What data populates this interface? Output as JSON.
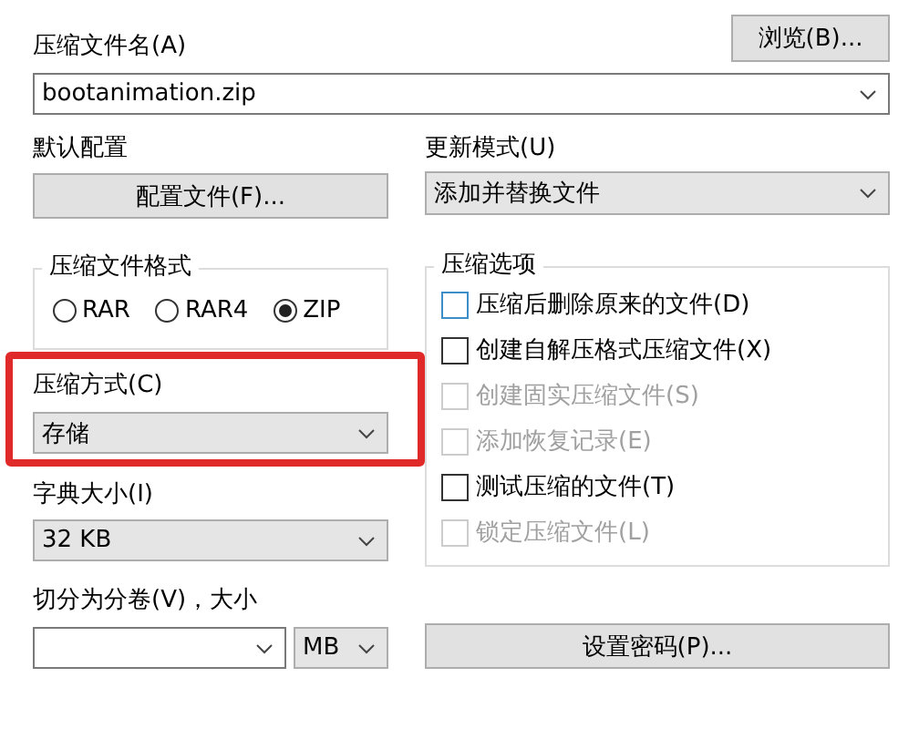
{
  "archive_name": {
    "label": "压缩文件名(A)",
    "value": "bootanimation.zip"
  },
  "browse_button": "浏览(B)...",
  "profile": {
    "label": "默认配置",
    "button": "配置文件(F)..."
  },
  "update_mode": {
    "label": "更新模式(U)",
    "value": "添加并替换文件"
  },
  "archive_format": {
    "title": "压缩文件格式",
    "options": [
      {
        "label": "RAR",
        "selected": false
      },
      {
        "label": "RAR4",
        "selected": false
      },
      {
        "label": "ZIP",
        "selected": true
      }
    ]
  },
  "compression_method": {
    "label": "压缩方式(C)",
    "value": "存储",
    "highlighted": true
  },
  "dictionary_size": {
    "label": "字典大小(I)",
    "value": "32 KB"
  },
  "split_volumes": {
    "label": "切分为分卷(V)，大小",
    "unit": "MB"
  },
  "options": {
    "title": "压缩选项",
    "items": [
      {
        "label": "压缩后删除原来的文件(D)",
        "checked": false,
        "disabled": false,
        "focused": true
      },
      {
        "label": "创建自解压格式压缩文件(X)",
        "checked": false,
        "disabled": false,
        "focused": false
      },
      {
        "label": "创建固实压缩文件(S)",
        "checked": false,
        "disabled": true,
        "focused": false
      },
      {
        "label": "添加恢复记录(E)",
        "checked": false,
        "disabled": true,
        "focused": false
      },
      {
        "label": "测试压缩的文件(T)",
        "checked": false,
        "disabled": false,
        "focused": false
      },
      {
        "label": "锁定压缩文件(L)",
        "checked": false,
        "disabled": true,
        "focused": false
      }
    ]
  },
  "password_button": "设置密码(P)..."
}
